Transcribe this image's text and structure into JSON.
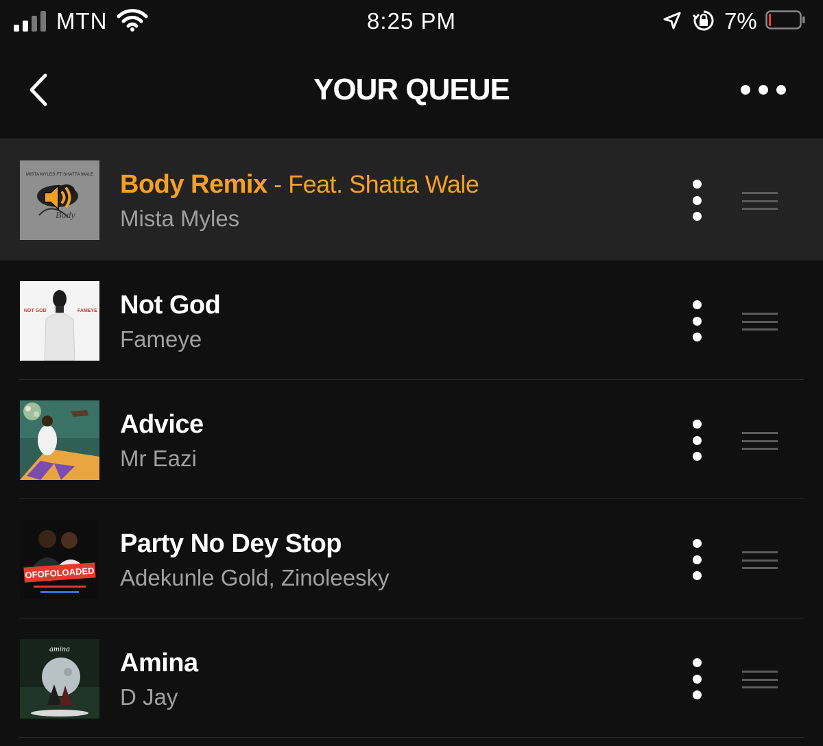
{
  "status_bar": {
    "carrier": "MTN",
    "time": "8:25 PM",
    "battery_percent": "7%",
    "battery_level": 0.07,
    "icons": [
      "signal-icon",
      "wifi-icon",
      "location-arrow-icon",
      "rotation-lock-icon",
      "battery-icon"
    ]
  },
  "header": {
    "title": "YOUR QUEUE",
    "back_icon": "chevron-left-icon",
    "more_icon": "more-horizontal-icon"
  },
  "colors": {
    "accent": "#f5a024",
    "background": "#101010",
    "playing_row": "#232323",
    "secondary_text": "#a0a0a0"
  },
  "queue": [
    {
      "title": "Body Remix",
      "feat": " - Feat. Shatta Wale",
      "artist": "Mista Myles",
      "now_playing": true,
      "indicator_icon": "speaker-icon"
    },
    {
      "title": "Not God",
      "feat": "",
      "artist": "Fameye",
      "now_playing": false
    },
    {
      "title": "Advice",
      "feat": "",
      "artist": "Mr Eazi",
      "now_playing": false
    },
    {
      "title": "Party No Dey Stop",
      "feat": "",
      "artist": "Adekunle Gold, Zinoleesky",
      "now_playing": false
    },
    {
      "title": "Amina",
      "feat": "",
      "artist": "D Jay",
      "now_playing": false
    }
  ],
  "cover_art_text": {
    "body_remix": "MISTA MYLES FT SHATTA WALE",
    "not_god_left": "NOT GOD",
    "not_god_right": "FAMEYE",
    "party_banner": "OFOFOLOADED",
    "amina": "amina"
  }
}
